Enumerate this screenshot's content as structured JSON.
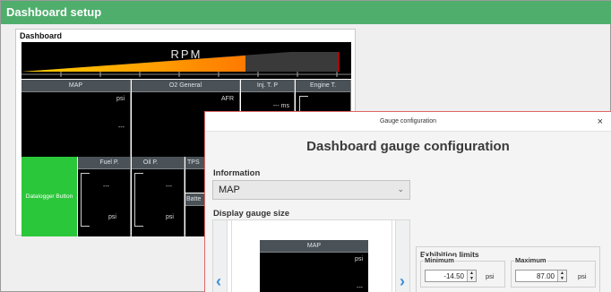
{
  "app": {
    "title": "Dashboard setup"
  },
  "panel": {
    "title": "Dashboard",
    "rpm": {
      "label": "RPM",
      "fill_fraction": 0.68
    },
    "gauges_top": [
      {
        "title": "MAP",
        "unit": "psi",
        "value": "---"
      },
      {
        "title": "O2 General",
        "unit": "AFR"
      },
      {
        "title": "Inj. T. P",
        "value": "--- ms"
      },
      {
        "title": "Engine T."
      }
    ],
    "logger_button": "Datalogger Button",
    "gauges_bottom": [
      {
        "title": "Fuel P.",
        "value": "---",
        "unit": "psi"
      },
      {
        "title": "Oil P.",
        "value": "---",
        "unit": "psi"
      },
      {
        "title": "TPS"
      },
      {
        "title": "Batte"
      }
    ]
  },
  "modal": {
    "title": "Gauge configuration",
    "heading": "Dashboard gauge configuration",
    "information_label": "Information",
    "selected_information": "MAP",
    "size_label": "Display gauge size",
    "preview": {
      "title": "MAP",
      "unit": "psi",
      "value": "---"
    },
    "limits": {
      "title": "Exhibition limits",
      "min_label": "Minimum",
      "min_value": "-14.50",
      "min_unit": "psi",
      "max_label": "Maximum",
      "max_value": "87.00",
      "max_unit": "psi"
    }
  },
  "icons": {
    "close": "×",
    "chevron_down": "⌄",
    "left_arrow": "‹",
    "right_arrow": "›",
    "spin_up": "▲",
    "spin_down": "▼"
  },
  "colors": {
    "title_green": "#4fae6c",
    "logger_green": "#2bc73a",
    "rpm_orange": "#ff8b00",
    "rpm_yellow": "#ffb400",
    "modal_border": "#e06565",
    "arrow_blue": "#3a8ed6"
  }
}
